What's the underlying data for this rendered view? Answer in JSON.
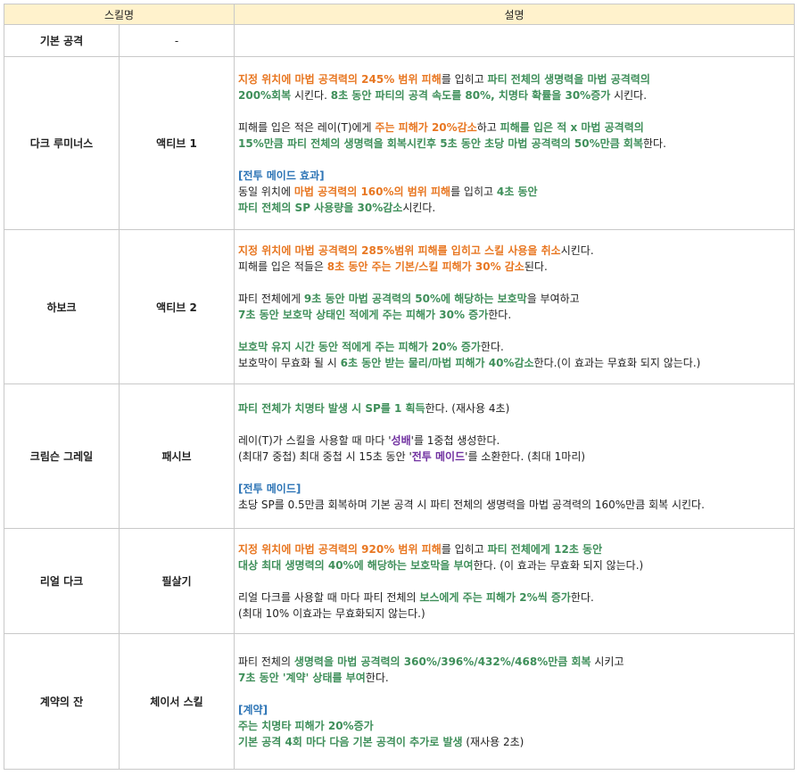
{
  "header": {
    "col_skill": "스킬명",
    "col_desc": "설명"
  },
  "rows": [
    {
      "name": "기본 공격",
      "type": "-",
      "lines": []
    },
    {
      "name": "다크 루미너스",
      "type": "액티브 1",
      "lines": [
        [
          [
            "o",
            "지정 위치에 마법 공격력의 245% 범위 피해"
          ],
          [
            "k",
            "를 입히고 "
          ],
          [
            "g",
            "파티 전체의 생명력을 마법 공격력의"
          ]
        ],
        [
          [
            "g",
            "200%회복"
          ],
          [
            "k",
            " 시킨다. "
          ],
          [
            "g",
            "8초 동안 파티의 공격 속도를 80%, 치명타 확률을 30%증가"
          ],
          [
            "k",
            " 시킨다."
          ]
        ],
        [],
        [
          [
            "k",
            "피해를 입은 적은 레이(T)에게 "
          ],
          [
            "o",
            "주는 피해가 20%감소"
          ],
          [
            "k",
            "하고 "
          ],
          [
            "g",
            "피해를 입은 적 x 마법 공격력의"
          ]
        ],
        [
          [
            "g",
            "15%만큼 파티 전체의 생명력을 회복시킨후 5초 동안 초당 마법 공격력의 50%만큼 회복"
          ],
          [
            "k",
            "한다."
          ]
        ],
        [],
        [
          [
            "b",
            "[전투 메이드 효과]"
          ]
        ],
        [
          [
            "k",
            "동일 위치에 "
          ],
          [
            "o",
            "마법 공격력의 160%의 범위 피해"
          ],
          [
            "k",
            "를 입히고 "
          ],
          [
            "g",
            "4초 동안"
          ]
        ],
        [
          [
            "g",
            "파티 전체의 SP 사용량을 30%감소"
          ],
          [
            "k",
            "시킨다."
          ]
        ]
      ]
    },
    {
      "name": "하보크",
      "type": "액티브 2",
      "lines": [
        [
          [
            "o",
            "지정 위치에 마법 공격력의 285%범위 피해를 입히고 스킬 사용을 취소"
          ],
          [
            "k",
            "시킨다."
          ]
        ],
        [
          [
            "k",
            "피해를 입은 적들은 "
          ],
          [
            "o",
            "8초 동안 주는 기본/스킬 피해가 30% 감소"
          ],
          [
            "k",
            "된다."
          ]
        ],
        [],
        [
          [
            "k",
            "파티 전체에게 "
          ],
          [
            "g",
            "9초 동안 마법 공격력의 50%에 해당하는 보호막"
          ],
          [
            "k",
            "을 부여하고"
          ]
        ],
        [
          [
            "g",
            "7초 동안 보호막 상태인 적에게 주는 피해가 30% 증가"
          ],
          [
            "k",
            "한다."
          ]
        ],
        [],
        [
          [
            "g",
            "보호막 유지 시간 동안 적에게 주는 피해가 20% 증가"
          ],
          [
            "k",
            "한다."
          ]
        ],
        [
          [
            "k",
            "보호막이 무효화 될 시 "
          ],
          [
            "g",
            "6초 동안 받는 물리/마법 피해가 40%감소"
          ],
          [
            "k",
            "한다.(이 효과는 무효화 되지 않는다.)"
          ]
        ]
      ]
    },
    {
      "name": "크림슨 그레일",
      "type": "패시브",
      "lines": [
        [
          [
            "g",
            "파티 전체가 치명타 발생 시 SP를 1 획득"
          ],
          [
            "k",
            "한다. (재사용 4초)"
          ]
        ],
        [],
        [
          [
            "k",
            "레이(T)가 스킬을 사용할 때 마다 '"
          ],
          [
            "p",
            "성배"
          ],
          [
            "k",
            "'를 1중첩 생성한다."
          ]
        ],
        [
          [
            "k",
            "(최대7 중첩) 최대 중첩 시 15초 동안 '"
          ],
          [
            "p",
            "전투 메이드"
          ],
          [
            "k",
            "'를 소환한다. (최대 1마리)"
          ]
        ],
        [],
        [
          [
            "b",
            "[전투 메이드]"
          ]
        ],
        [
          [
            "k",
            "초당 SP를 0.5만큼 회복하며 기본 공격 시 파티 전체의 생명력을 마법 공격력의 160%만큼 회복 시킨다."
          ]
        ]
      ]
    },
    {
      "name": "리얼 다크",
      "type": "필살기",
      "lines": [
        [
          [
            "o",
            "지정 위치에 마법 공격력의 920% 범위 피해"
          ],
          [
            "k",
            "를 입히고 "
          ],
          [
            "g",
            "파티 전체에게 12초 동안"
          ]
        ],
        [
          [
            "g",
            "대상 최대 생명력의 40%에 해당하는 보호막을 부여"
          ],
          [
            "k",
            "한다. (이 효과는 무효화 되지 않는다.)"
          ]
        ],
        [],
        [
          [
            "k",
            "리얼 다크를 사용할 때 마다 파티 전체의 "
          ],
          [
            "g",
            "보스에게 주는 피해가 2%씩 증가"
          ],
          [
            "k",
            "한다."
          ]
        ],
        [
          [
            "k",
            "(최대 10% 이효과는 무효화되지 않는다.)"
          ]
        ]
      ]
    },
    {
      "name": "계약의 잔",
      "type": "체이서 스킬",
      "lines": [
        [
          [
            "k",
            "파티 전체의 "
          ],
          [
            "g",
            "생명력을 마법 공격력의 360%/396%/432%/468%만큼 회복"
          ],
          [
            "k",
            " 시키고"
          ]
        ],
        [
          [
            "g",
            "7초 동안 '계약' 상태를 부여"
          ],
          [
            "k",
            "한다."
          ]
        ],
        [],
        [
          [
            "b",
            "[계약]"
          ]
        ],
        [
          [
            "g",
            "주는 치명타 피해가 20%증가"
          ]
        ],
        [
          [
            "g",
            "기본 공격 4회 마다 다음 기본 공격이 추가로 발생"
          ],
          [
            "k",
            " (재사용 2초)"
          ]
        ]
      ]
    }
  ],
  "colors": {
    "orange": "#e87722",
    "green": "#3f8f5a",
    "blue": "#2e75b6",
    "purple": "#7030a0",
    "header_bg": "#fff2cc"
  }
}
